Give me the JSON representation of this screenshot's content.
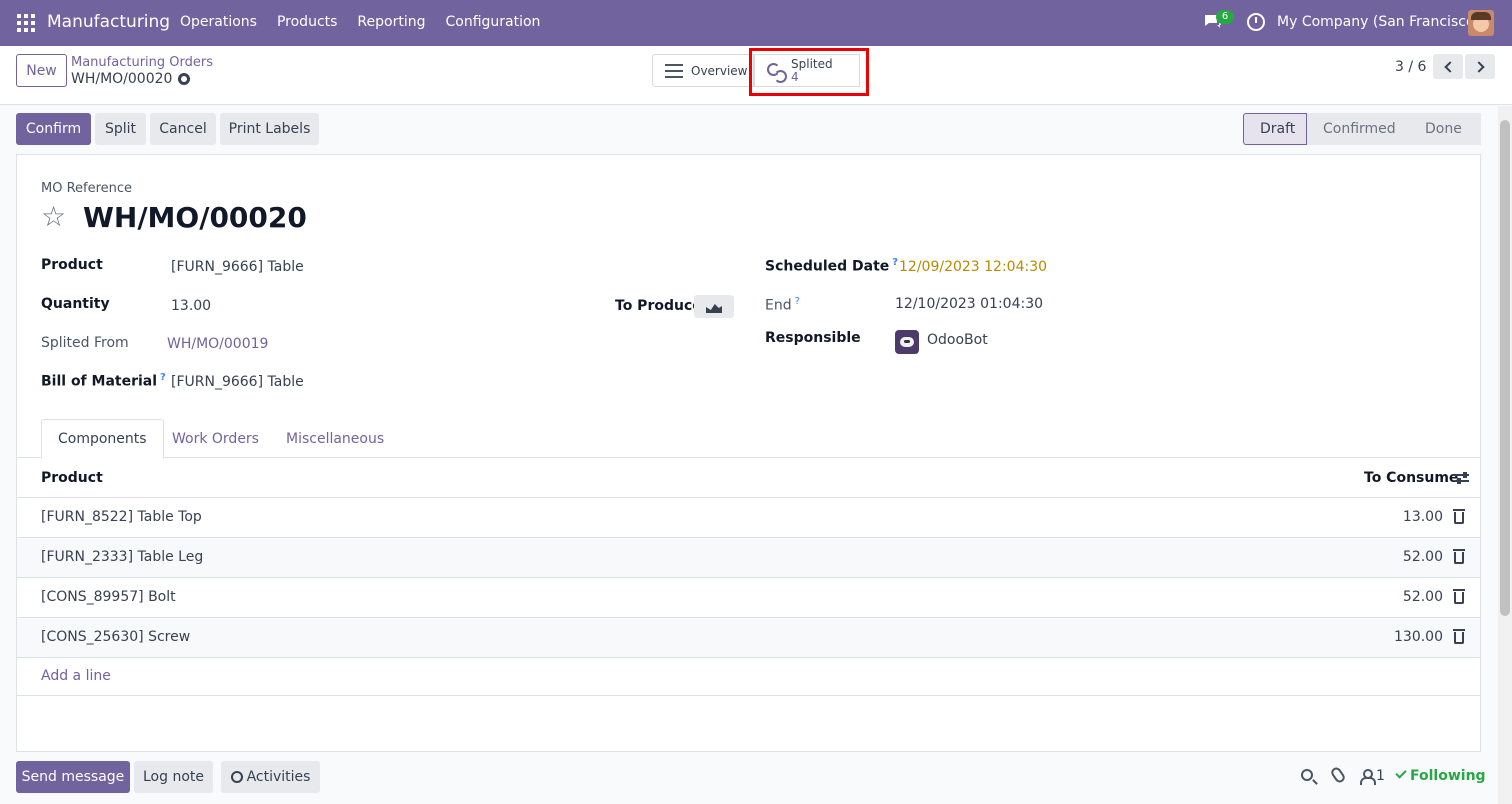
{
  "navbar": {
    "app_name": "Manufacturing",
    "menu": [
      "Operations",
      "Products",
      "Reporting",
      "Configuration"
    ],
    "chat_badge": "6",
    "company": "My Company (San Francisco)"
  },
  "control": {
    "new_label": "New",
    "breadcrumb": "Manufacturing Orders",
    "record_name": "WH/MO/00020",
    "smart_overview": "Overview",
    "smart_splited_label": "Splited",
    "smart_splited_count": "4",
    "pager": "3 / 6"
  },
  "actions": {
    "confirm": "Confirm",
    "split": "Split",
    "cancel": "Cancel",
    "print_labels": "Print Labels"
  },
  "status": [
    "Draft",
    "Confirmed",
    "Done"
  ],
  "form": {
    "ref_label": "MO Reference",
    "title": "WH/MO/00020",
    "product_label": "Product",
    "product_value": "[FURN_9666] Table",
    "quantity_label": "Quantity",
    "quantity_value": "13.00",
    "to_produce_label": "To Produce",
    "splited_from_label": "Splited From",
    "splited_from_value": "WH/MO/00019",
    "bom_label": "Bill of Material",
    "bom_help": "?",
    "bom_value": "[FURN_9666] Table",
    "scheduled_label": "Scheduled Date",
    "scheduled_help": "?",
    "scheduled_value": "12/09/2023 12:04:30",
    "end_label": "End",
    "end_help": "?",
    "end_value": "12/10/2023 01:04:30",
    "responsible_label": "Responsible",
    "responsible_value": "OdooBot"
  },
  "tabs": [
    "Components",
    "Work Orders",
    "Miscellaneous"
  ],
  "table": {
    "col_product": "Product",
    "col_consume": "To Consume",
    "rows": [
      {
        "product": "[FURN_8522] Table Top",
        "qty": "13.00"
      },
      {
        "product": "[FURN_2333] Table Leg",
        "qty": "52.00"
      },
      {
        "product": "[CONS_89957] Bolt",
        "qty": "52.00"
      },
      {
        "product": "[CONS_25630] Screw",
        "qty": "130.00"
      }
    ],
    "add_line": "Add a line"
  },
  "chatter": {
    "send_message": "Send message",
    "log_note": "Log note",
    "activities": "Activities",
    "followers_count": "1",
    "following": "Following"
  },
  "colors": {
    "brand": "#71639e",
    "highlight": "#ee0000",
    "date_warning": "#b78a00",
    "following": "#28a745"
  }
}
